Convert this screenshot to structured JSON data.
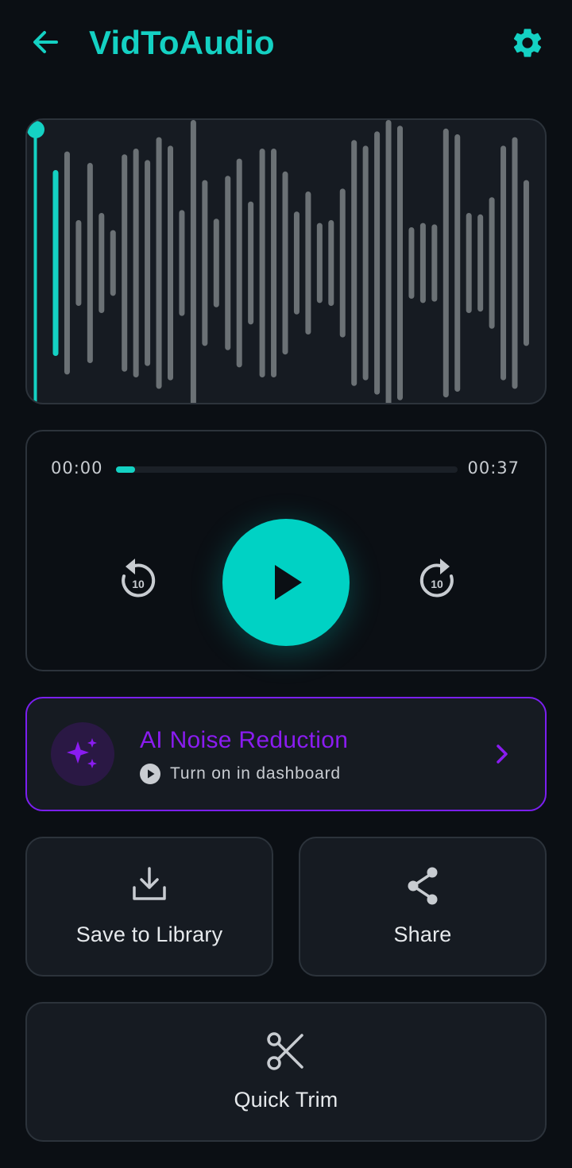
{
  "header": {
    "title": "VidToAudio",
    "back_icon": "arrow-left-icon",
    "settings_icon": "gear-icon"
  },
  "waveform": {
    "bars": [
      0.65,
      0.78,
      0.3,
      0.7,
      0.35,
      0.23,
      0.76,
      0.8,
      0.72,
      0.88,
      0.82,
      0.37,
      1.0,
      0.58,
      0.31,
      0.61,
      0.73,
      0.43,
      0.8,
      0.8,
      0.64,
      0.36,
      0.5,
      0.28,
      0.3,
      0.52,
      0.86,
      0.82,
      0.92,
      1.0,
      0.96,
      0.25,
      0.28,
      0.27,
      0.94,
      0.9,
      0.35,
      0.34,
      0.46,
      0.82,
      0.88,
      0.58
    ],
    "played_fraction": 0.0,
    "accent": "#14d1c3",
    "bar_color": "#6b7175"
  },
  "player": {
    "current_time": "00:00",
    "total_time": "00:37",
    "progress": 0.055,
    "skip_back_label": "10",
    "skip_forward_label": "10",
    "play_icon": "play-icon"
  },
  "ai_card": {
    "title": "AI Noise Reduction",
    "subtitle": "Turn on in dashboard",
    "icon": "sparkles-icon",
    "accent": "#8a1cf0"
  },
  "actions": {
    "save_label": "Save to Library",
    "share_label": "Share",
    "trim_label": "Quick Trim"
  }
}
